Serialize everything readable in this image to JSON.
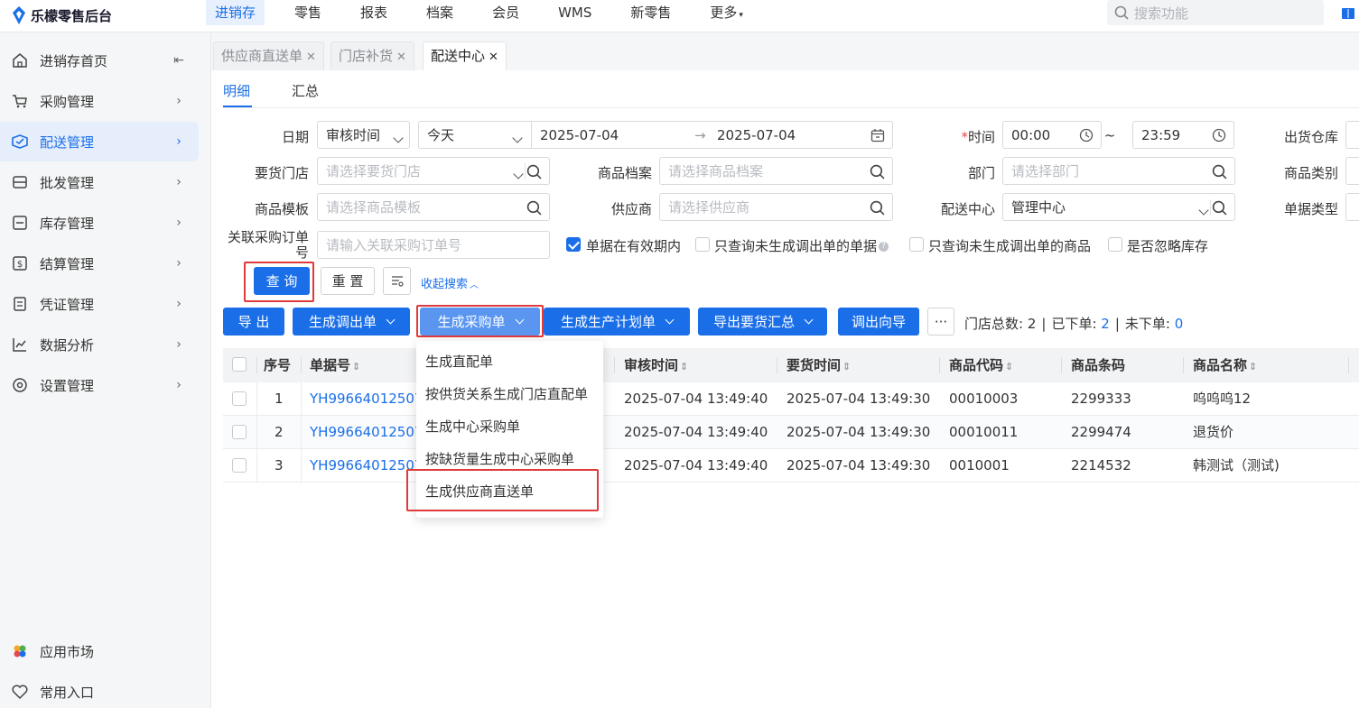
{
  "app": {
    "title": "乐檬零售后台"
  },
  "topnav": [
    {
      "label": "进销存",
      "active": true
    },
    {
      "label": "零售"
    },
    {
      "label": "报表"
    },
    {
      "label": "档案"
    },
    {
      "label": "会员"
    },
    {
      "label": "WMS"
    },
    {
      "label": "新零售"
    },
    {
      "label": "更多"
    }
  ],
  "search": {
    "placeholder": "搜索功能"
  },
  "sidebar": {
    "items": [
      {
        "label": "进销存首页",
        "icon": "home-icon"
      },
      {
        "label": "采购管理",
        "icon": "cart-icon"
      },
      {
        "label": "配送管理",
        "icon": "delivery-icon",
        "active": true
      },
      {
        "label": "批发管理",
        "icon": "wholesale-icon"
      },
      {
        "label": "库存管理",
        "icon": "inventory-icon"
      },
      {
        "label": "结算管理",
        "icon": "settlement-icon"
      },
      {
        "label": "凭证管理",
        "icon": "voucher-icon"
      },
      {
        "label": "数据分析",
        "icon": "chart-icon"
      },
      {
        "label": "设置管理",
        "icon": "settings-icon"
      }
    ],
    "bottom": [
      {
        "label": "应用市场",
        "icon": "app-market-icon"
      },
      {
        "label": "常用入口",
        "icon": "heart-icon"
      }
    ]
  },
  "page_tabs": [
    {
      "label": "供应商直送单"
    },
    {
      "label": "门店补货"
    },
    {
      "label": "配送中心",
      "active": true
    }
  ],
  "subtabs": {
    "detail": "明细",
    "summary": "汇总"
  },
  "filters": {
    "date_label": "日期",
    "date_type": "审核时间",
    "date_range": "今天",
    "date_from": "2025-07-04",
    "date_to": "2025-07-04",
    "time_label": "时间",
    "time_required": "*",
    "time_from": "00:00",
    "time_to": "23:59",
    "time_sep": "~",
    "warehouse_label": "出货仓库",
    "store_label": "要货门店",
    "store_placeholder": "请选择要货门店",
    "product_label": "商品档案",
    "product_placeholder": "请选择商品档案",
    "dept_label": "部门",
    "dept_placeholder": "请选择部门",
    "category_label": "商品类别",
    "template_label": "商品模板",
    "template_placeholder": "请选择商品模板",
    "supplier_label": "供应商",
    "supplier_placeholder": "请选择供应商",
    "center_label": "配送中心",
    "center_value": "管理中心",
    "doctype_label": "单据类型",
    "po_label": "关联采购订单号",
    "po_placeholder": "请输入关联采购订单号"
  },
  "checks": [
    {
      "label": "单据在有效期内",
      "checked": true
    },
    {
      "label": "只查询未生成调出单的单据",
      "checked": false
    },
    {
      "label": "只查询未生成调出单的商品",
      "checked": false
    },
    {
      "label": "是否忽略库存",
      "checked": false
    }
  ],
  "actions": {
    "query": "查 询",
    "reset": "重 置",
    "collapse": "收起搜索",
    "export": "导 出",
    "gen_transfer": "生成调出单",
    "gen_purchase": "生成采购单",
    "gen_production": "生成生产计划单",
    "export_summary": "导出要货汇总",
    "transfer_guide": "调出向导",
    "more": "···"
  },
  "stats": {
    "total_label": "门店总数:",
    "total": "2",
    "ordered_label": "已下单:",
    "ordered": "2",
    "pending_label": "未下单:",
    "pending": "0"
  },
  "dropdown": [
    "生成直配单",
    "按供货关系生成门店直配单",
    "生成中心采购单",
    "按缺货量生成中心采购单",
    "生成供应商直送单"
  ],
  "table": {
    "columns": [
      "序号",
      "单据号",
      "审核时间",
      "要货时间",
      "商品代码",
      "商品条码",
      "商品名称"
    ],
    "rows": [
      {
        "no": "1",
        "doc": "YH99664012507",
        "audit": "2025-07-04 13:49:40",
        "req": "2025-07-04 13:49:30",
        "code": "00010003",
        "barcode": "2299333",
        "name": "呜呜呜12"
      },
      {
        "no": "2",
        "doc": "YH99664012507",
        "audit": "2025-07-04 13:49:40",
        "req": "2025-07-04 13:49:30",
        "code": "00010011",
        "barcode": "2299474",
        "name": "退货价"
      },
      {
        "no": "3",
        "doc": "YH99664012507",
        "audit": "2025-07-04 13:49:40",
        "req": "2025-07-04 13:49:30",
        "code": "0010001",
        "barcode": "2214532",
        "name": "韩测试（测试)"
      }
    ]
  },
  "colors": {
    "primary": "#1a6fe8",
    "highlight": "#e03a3a"
  }
}
